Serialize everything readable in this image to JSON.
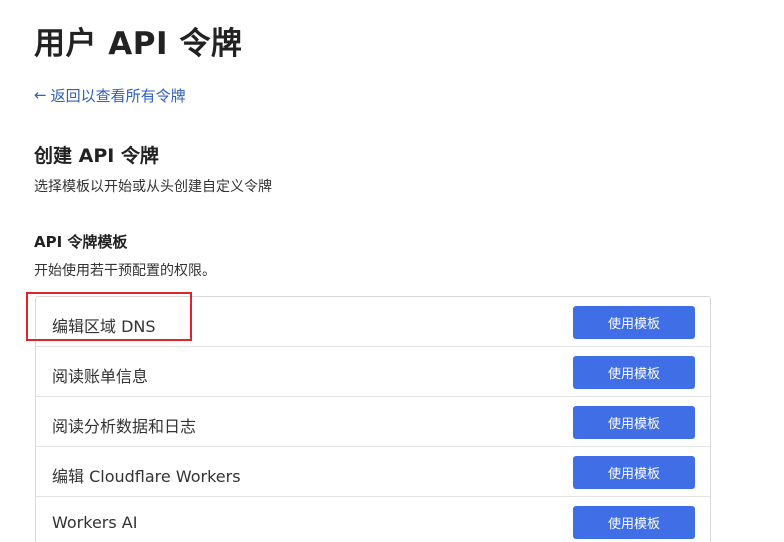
{
  "header": {
    "title": "用户 API 令牌",
    "back_link": "返回以查看所有令牌",
    "back_arrow": "←"
  },
  "create_section": {
    "title": "创建 API 令牌",
    "description": "选择模板以开始或从头创建自定义令牌"
  },
  "templates": {
    "title": "API 令牌模板",
    "description": "开始使用若干预配置的权限。",
    "button_label": "使用模板",
    "rows": [
      {
        "label": "编辑区域 DNS",
        "button": "使用模板"
      },
      {
        "label": "阅读账单信息",
        "button": "使用模板"
      },
      {
        "label": "阅读分析数据和日志",
        "button": "使用模板"
      },
      {
        "label": "编辑 Cloudflare Workers",
        "button": "使用模板"
      },
      {
        "label": "Workers AI",
        "button": "使用模板"
      }
    ]
  },
  "colors": {
    "accent_button": "#3f6ee7",
    "link": "#2f5fbf",
    "highlight": "#e0242b"
  }
}
